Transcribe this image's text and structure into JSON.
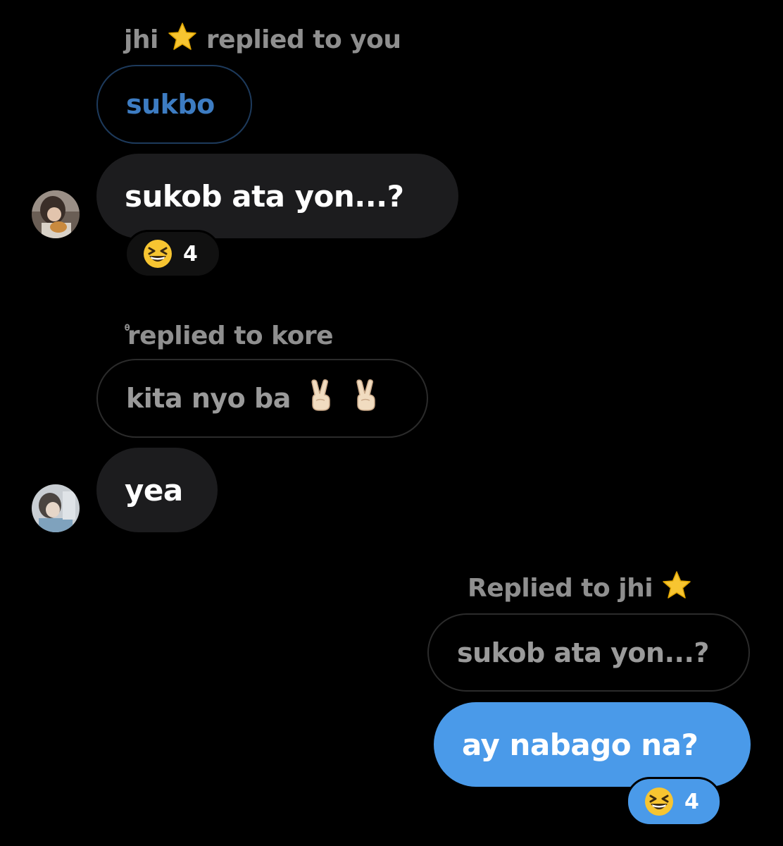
{
  "messages": {
    "msg1": {
      "reply_name": "jhi",
      "reply_star": "star-emoji",
      "reply_text": "replied to you",
      "quoted_text": "sukbo",
      "bubble_text": "sukob ata yon...?",
      "reaction_emoji": "grinning-squinting-face-emoji",
      "reaction_count": "4"
    },
    "msg2": {
      "reply_prefix": "ᶿ",
      "reply_text": "replied to kore",
      "quoted_text": "kita nyo ba",
      "quoted_emojis": [
        "victory-hand-emoji",
        "victory-hand-emoji"
      ],
      "bubble_text": "yea"
    },
    "msg3": {
      "reply_text": "Replied to jhi",
      "reply_star": "star-emoji",
      "quoted_text": "sukob ata yon...?",
      "bubble_text": "ay nabago na?",
      "reaction_emoji": "grinning-squinting-face-emoji",
      "reaction_count": "4"
    }
  },
  "colors": {
    "background": "#000000",
    "incoming_bubble": "#1c1c1e",
    "outgoing_bubble": "#4a9ae9",
    "muted_text": "#8f8f8f",
    "link_blue": "#3d7cc2"
  }
}
